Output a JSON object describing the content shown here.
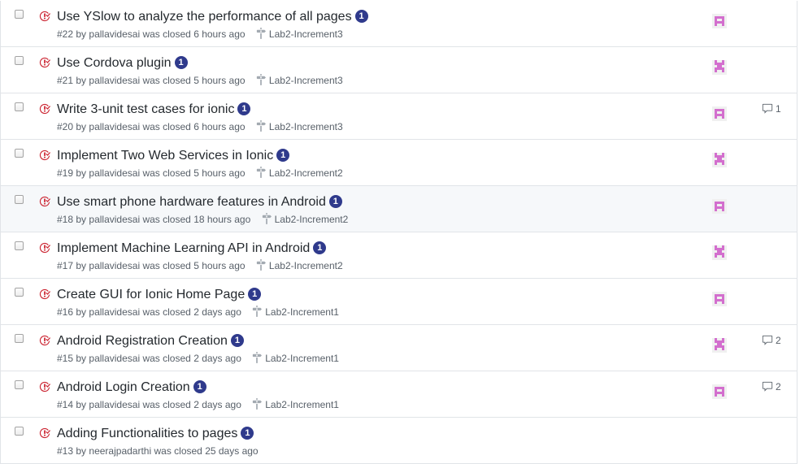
{
  "issues": [
    {
      "title": "Use YSlow to analyze the performance of all pages",
      "task_count": "1",
      "number": "#22",
      "by": "by",
      "author": "pallavidesai",
      "closed_text": "was closed",
      "time": "6 hours ago",
      "milestone": "Lab2-Increment3",
      "avatar_style": "a",
      "comments": ""
    },
    {
      "title": "Use Cordova plugin",
      "task_count": "1",
      "number": "#21",
      "by": "by",
      "author": "pallavidesai",
      "closed_text": "was closed",
      "time": "5 hours ago",
      "milestone": "Lab2-Increment3",
      "avatar_style": "b",
      "comments": ""
    },
    {
      "title": "Write 3-unit test cases for ionic",
      "task_count": "1",
      "number": "#20",
      "by": "by",
      "author": "pallavidesai",
      "closed_text": "was closed",
      "time": "6 hours ago",
      "milestone": "Lab2-Increment3",
      "avatar_style": "a",
      "comments": "1"
    },
    {
      "title": "Implement Two Web Services in Ionic",
      "task_count": "1",
      "number": "#19",
      "by": "by",
      "author": "pallavidesai",
      "closed_text": "was closed",
      "time": "5 hours ago",
      "milestone": "Lab2-Increment2",
      "avatar_style": "b",
      "comments": ""
    },
    {
      "title": "Use smart phone hardware features in Android",
      "task_count": "1",
      "number": "#18",
      "by": "by",
      "author": "pallavidesai",
      "closed_text": "was closed",
      "time": "18 hours ago",
      "milestone": "Lab2-Increment2",
      "avatar_style": "a",
      "comments": ""
    },
    {
      "title": "Implement Machine Learning API in Android",
      "task_count": "1",
      "number": "#17",
      "by": "by",
      "author": "pallavidesai",
      "closed_text": "was closed",
      "time": "5 hours ago",
      "milestone": "Lab2-Increment2",
      "avatar_style": "b",
      "comments": ""
    },
    {
      "title": "Create GUI for Ionic Home Page",
      "task_count": "1",
      "number": "#16",
      "by": "by",
      "author": "pallavidesai",
      "closed_text": "was closed",
      "time": "2 days ago",
      "milestone": "Lab2-Increment1",
      "avatar_style": "a",
      "comments": ""
    },
    {
      "title": "Android Registration Creation",
      "task_count": "1",
      "number": "#15",
      "by": "by",
      "author": "pallavidesai",
      "closed_text": "was closed",
      "time": "2 days ago",
      "milestone": "Lab2-Increment1",
      "avatar_style": "b",
      "comments": "2"
    },
    {
      "title": "Android Login Creation",
      "task_count": "1",
      "number": "#14",
      "by": "by",
      "author": "pallavidesai",
      "closed_text": "was closed",
      "time": "2 days ago",
      "milestone": "Lab2-Increment1",
      "avatar_style": "a",
      "comments": "2"
    },
    {
      "title": "Adding Functionalities to pages",
      "task_count": "1",
      "number": "#13",
      "by": "by",
      "author": "neerajpadarthi",
      "closed_text": "was closed",
      "time": "25 days ago",
      "milestone": "",
      "avatar_style": "",
      "comments": ""
    }
  ],
  "hovered_index": 4,
  "colors": {
    "closed_icon": "#cb2431",
    "task_badge": "#2f3a8c",
    "avatar_pink": "#d36fce",
    "border": "#e1e4e8",
    "meta_text": "#586069"
  },
  "icons": {
    "state": "issue-closed-icon",
    "milestone": "milestone-icon",
    "comment": "comment-icon",
    "avatar": "identicon-avatar"
  }
}
